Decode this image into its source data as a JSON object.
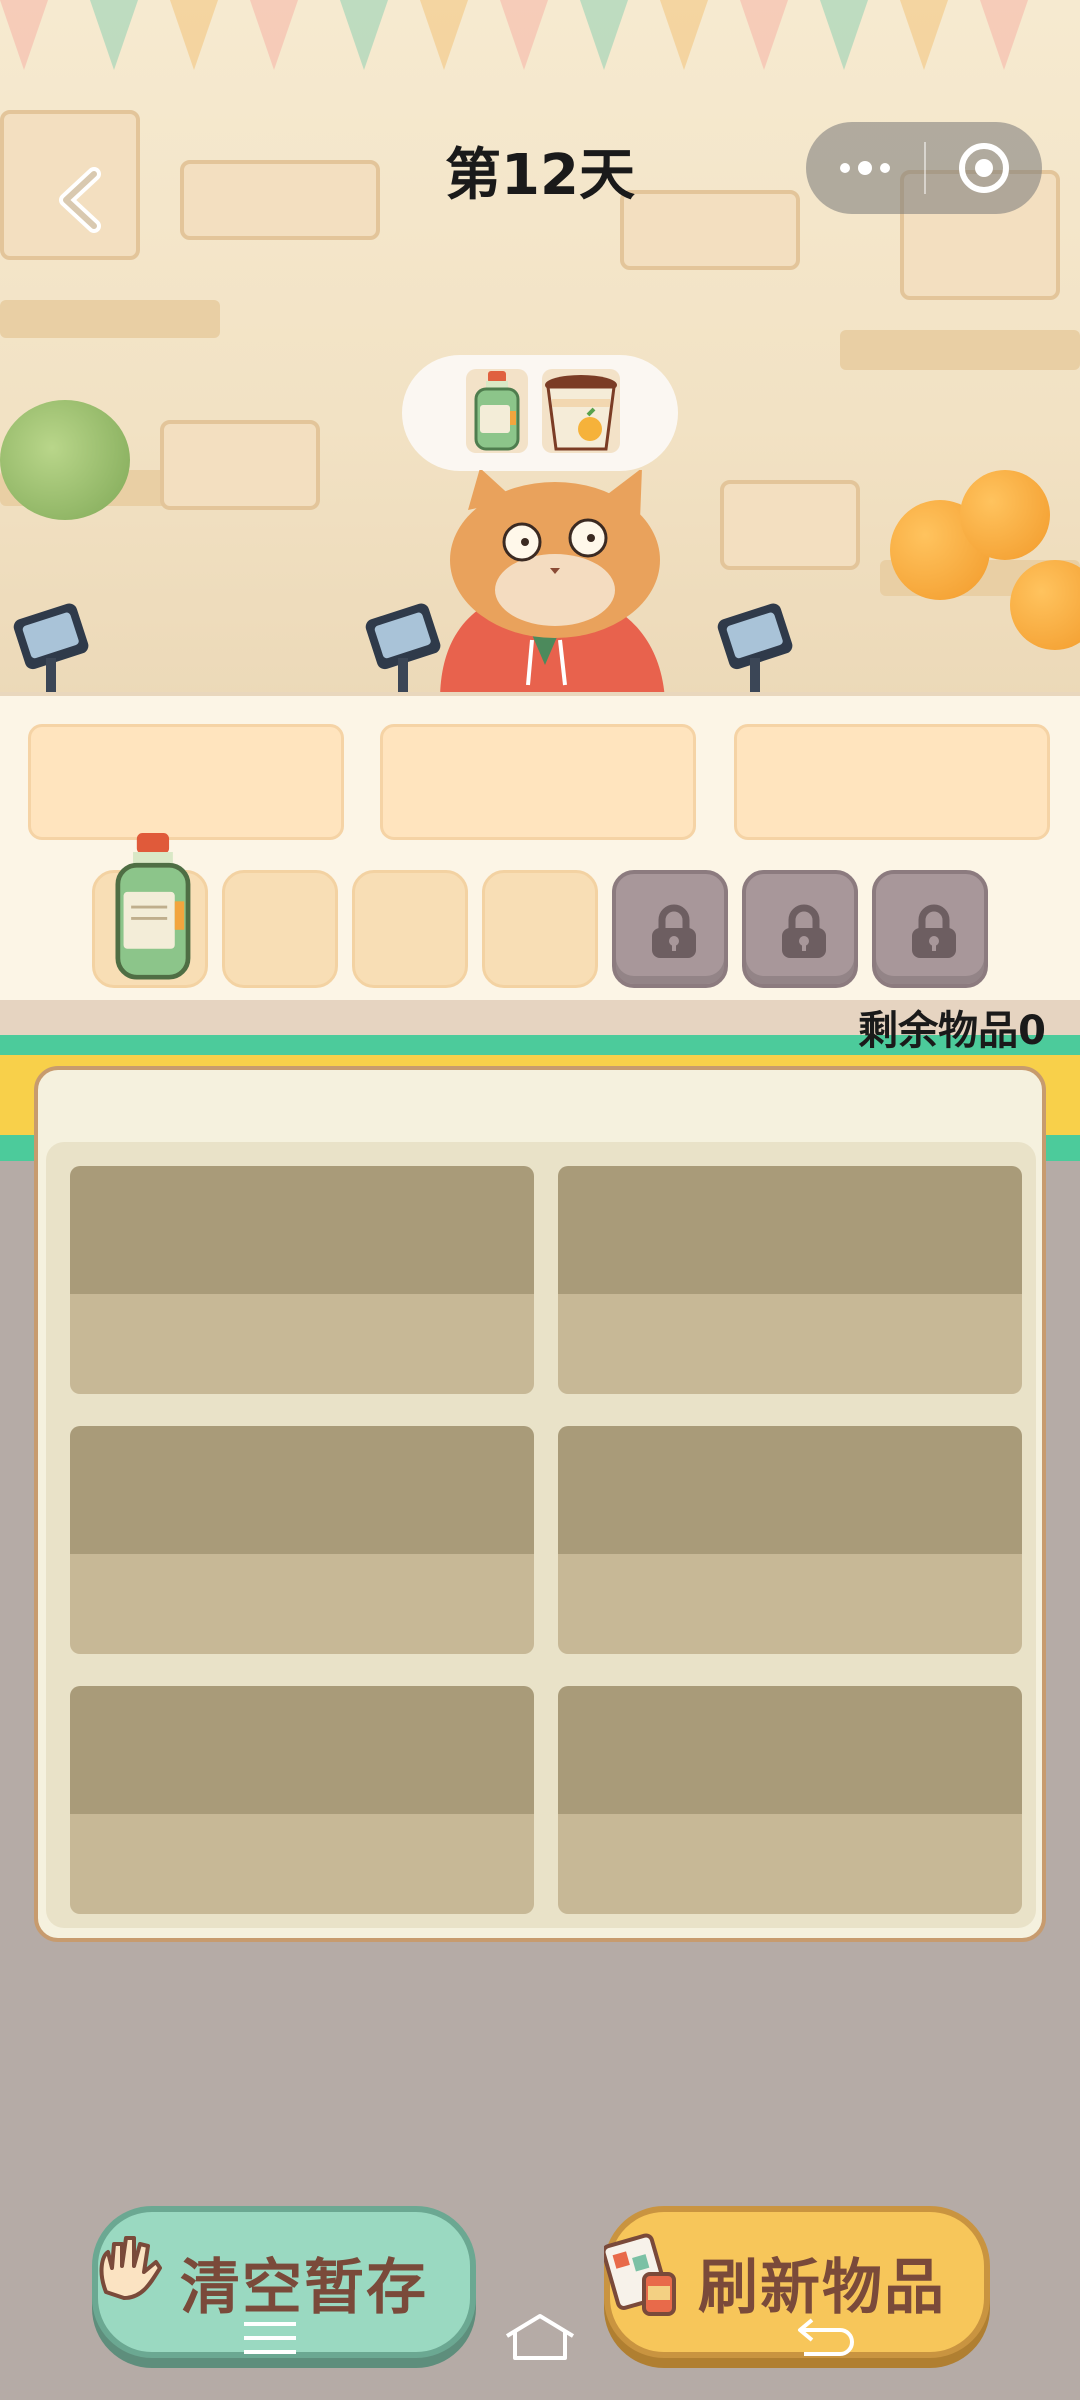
{
  "header": {
    "title": "第12天"
  },
  "order_bubble": {
    "items": [
      "green-bottle",
      "mango-ice-cream-cup"
    ]
  },
  "counter": {
    "slot_count": 3,
    "held_items": [
      "green-bottle"
    ],
    "unlocked_slots": 4,
    "locked_slots": 3
  },
  "status": {
    "remaining_label": "剩余物品0"
  },
  "shelf_grid": {
    "rows": 3,
    "cols": 2
  },
  "actions": {
    "clear_label": "清空暂存",
    "refresh_label": "刷新物品"
  },
  "colors": {
    "clear_button": "#9ad9c1",
    "refresh_button": "#f7c65a",
    "stripe_green": "#4ccb9b",
    "stripe_yellow": "#f8d04a"
  }
}
